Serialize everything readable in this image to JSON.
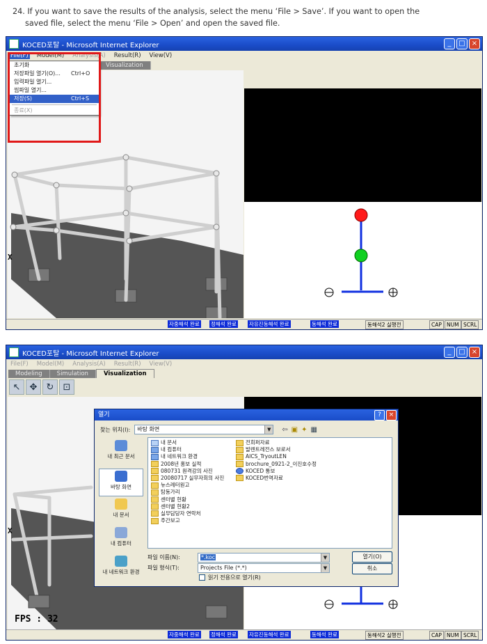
{
  "instruction": {
    "line1": "24. If you want to save the results of the analysis, select the menu ‘File > Save’. If you want to open the",
    "line2": "saved file, select the menu ‘File > Open’ and open the saved file."
  },
  "window": {
    "title": "KOCED포탈 - Microsoft Internet Explorer",
    "menu": [
      "File(F)",
      "Model(M)",
      "Analysis(A)",
      "Result(R)",
      "View(V)"
    ],
    "tabs": [
      "Modeling",
      "Simulation",
      "Visualization"
    ],
    "active_tab": "Visualization",
    "fps": "FPS  :  32",
    "axis_label": "X",
    "status": [
      "자중해석 완료",
      "정해석 완료",
      "자유진동해석 완료",
      "동해석 완료",
      "동해석2 실행전",
      "CAP",
      "NUM",
      "SCRL"
    ]
  },
  "file_menu": {
    "items": [
      {
        "label": "초기화",
        "shortcut": ""
      },
      {
        "label": "저장파일 열기(O)...",
        "shortcut": "Ctrl+O"
      },
      {
        "label": "입력파일 열기...",
        "shortcut": ""
      },
      {
        "label": "씹파일 열기...",
        "shortcut": ""
      },
      {
        "label": "저장(S)",
        "shortcut": "Ctrl+S"
      },
      {
        "label": "종료(X)",
        "shortcut": ""
      }
    ],
    "selected": "저장(S)"
  },
  "open_dialog": {
    "title": "열기",
    "look_in_label": "찾는 위치(I):",
    "look_in_value": "바탕 화면",
    "places": [
      "내 최근 문서",
      "바탕 화면",
      "내 문서",
      "내 컴퓨터",
      "내 네트워크 환경"
    ],
    "files_col1": [
      "내 문서",
      "내 컴퓨터",
      "내 네트워크 환경",
      "2008년 홍보 실적",
      "080731 원격강의 사진",
      "20080717 실무자회의 사진",
      "뉴스레터원고",
      "탐동가리",
      "센터별 현황",
      "센터별 현황2",
      "실무담당자 연락처",
      "주간보고"
    ],
    "files_col2": [
      "전희퍼자료",
      "발렌트레전스 보로서",
      "AICS_TryoutLEN",
      "brochure_0921-2_이진호수정",
      "KOCED 통보",
      "KOCED번역자료"
    ],
    "filename_label": "파일 이름(N):",
    "filename_value": "*.koc",
    "filetype_label": "파일 형식(T):",
    "filetype_value": "Projects File (*.*)",
    "readonly_label": "읽기 전용으로 열기(R)",
    "open_button": "열기(O)",
    "cancel_button": "취소"
  },
  "colors": {
    "titlebar": "#1a4cc8",
    "status_blue": "#0d2bd8",
    "menu_highlight": "#e01818",
    "ball_top": "#ff1a1a",
    "ball_bottom": "#10d020",
    "stem": "#1030e0"
  }
}
